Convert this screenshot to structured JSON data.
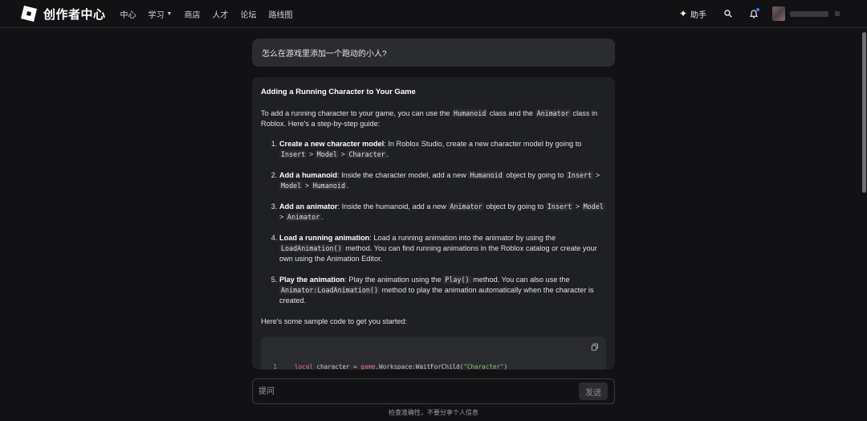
{
  "header": {
    "brand": "创作者中心",
    "nav": [
      {
        "label": "中心",
        "has_dropdown": false
      },
      {
        "label": "学习",
        "has_dropdown": true
      },
      {
        "label": "商店",
        "has_dropdown": false
      },
      {
        "label": "人才",
        "has_dropdown": false
      },
      {
        "label": "论坛",
        "has_dropdown": false
      },
      {
        "label": "路线图",
        "has_dropdown": false
      }
    ],
    "assistant_label": "助手",
    "icons": [
      "sparkle-icon",
      "search-icon",
      "bell-icon",
      "avatar"
    ]
  },
  "chat": {
    "question": "怎么在游戏里添加一个跑动的小人?",
    "answer": {
      "title": "Adding a Running Character to Your Game",
      "intro": {
        "pre": "To add a running character to your game, you can use the ",
        "code1": "Humanoid",
        "mid": " class and the ",
        "code2": "Animator",
        "post": " class in Roblox. Here's a step-by-step guide:"
      },
      "steps": [
        {
          "bold": "Create a new character model",
          "text": ": In Roblox Studio, create a new character model by going to ",
          "c1": "Insert",
          "sep1": " > ",
          "c2": "Model",
          "sep2": " > ",
          "c3": "Character",
          "end": "."
        },
        {
          "bold": "Add a humanoid",
          "text": ": Inside the character model, add a new ",
          "c0": "Humanoid",
          "text2": " object by going to ",
          "c1": "Insert",
          "sep1": " > ",
          "c2": "Model",
          "sep2": " > ",
          "c3": "Humanoid",
          "end": "."
        },
        {
          "bold": "Add an animator",
          "text": ": Inside the humanoid, add a new ",
          "c0": "Animator",
          "text2": " object by going to ",
          "c1": "Insert",
          "sep1": " > ",
          "c2": "Model",
          "sep2": " > ",
          "c3": "Animator",
          "end": "."
        },
        {
          "bold": "Load a running animation",
          "text": ": Load a running animation into the animator by using the ",
          "c0": "LoadAnimation()",
          "text2": " method. You can find running animations in the Roblox catalog or create your own using the Animation Editor."
        },
        {
          "bold": "Play the animation",
          "text": ": Play the animation using the ",
          "c0": "Play()",
          "text2": " method. You can also use the ",
          "c1": "Animator:LoadAnimation()",
          "text3": " method to play the animation automatically when the character is created."
        }
      ],
      "outro": "Here's some sample code to get you started:",
      "code": {
        "line_number": "1",
        "kw": "local",
        "var": " character = ",
        "game": "game",
        "rest": ".Workspace:WaitForChild(",
        "str": "\"Character\"",
        "close": ")"
      }
    }
  },
  "input": {
    "placeholder": "提问",
    "send_label": "发送"
  },
  "disclaimer": "检查准确性，不要分享个人信息"
}
